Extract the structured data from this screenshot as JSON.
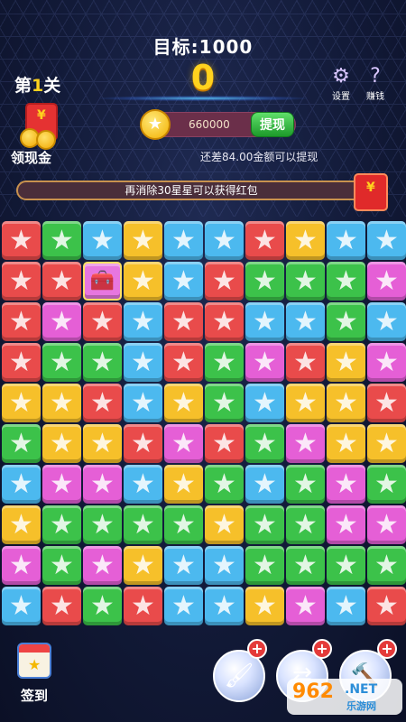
{
  "header": {
    "target_label": "目标:1000",
    "score": "0",
    "level_prefix": "第",
    "level_num": "1",
    "level_suffix": "关"
  },
  "top_icons": {
    "settings": {
      "icon": "gear-icon",
      "label": "设置"
    },
    "earn": {
      "icon": "question-icon",
      "label": "赚钱"
    }
  },
  "reward": {
    "claim_label": "领现金",
    "balance": "660000",
    "withdraw_label": "提现",
    "diff_text": "还差84.00金额可以提现"
  },
  "progress": {
    "text": "再消除30星星可以获得红包",
    "fraction": 0.0
  },
  "colors": {
    "red": "#e94b4b",
    "green": "#3cc24a",
    "blue": "#4cb9ef",
    "yellow": "#f6c02a",
    "pink": "#e55fd6"
  },
  "board": [
    [
      "red",
      "green",
      "blue",
      "yellow",
      "blue",
      "blue",
      "red",
      "yellow",
      "blue",
      "blue"
    ],
    [
      "red",
      "red",
      "chest",
      "yellow",
      "blue",
      "red",
      "green",
      "green",
      "green",
      "pink"
    ],
    [
      "red",
      "pink",
      "red",
      "blue",
      "red",
      "red",
      "blue",
      "blue",
      "green",
      "blue"
    ],
    [
      "red",
      "green",
      "green",
      "blue",
      "red",
      "green",
      "pink",
      "red",
      "yellow",
      "pink"
    ],
    [
      "yellow",
      "yellow",
      "red",
      "blue",
      "yellow",
      "green",
      "blue",
      "yellow",
      "yellow",
      "red"
    ],
    [
      "green",
      "yellow",
      "yellow",
      "red",
      "pink",
      "red",
      "green",
      "pink",
      "yellow",
      "yellow"
    ],
    [
      "blue",
      "pink",
      "pink",
      "blue",
      "yellow",
      "green",
      "blue",
      "green",
      "pink",
      "green"
    ],
    [
      "yellow",
      "green",
      "green",
      "green",
      "green",
      "yellow",
      "green",
      "green",
      "pink",
      "pink"
    ],
    [
      "pink",
      "green",
      "pink",
      "yellow",
      "blue",
      "blue",
      "green",
      "green",
      "green",
      "green"
    ],
    [
      "blue",
      "red",
      "green",
      "red",
      "blue",
      "blue",
      "yellow",
      "pink",
      "blue",
      "red"
    ]
  ],
  "bottom": {
    "checkin_label": "签到",
    "tools": [
      "brush-icon",
      "swap-icon",
      "hammer-icon"
    ]
  },
  "watermark": {
    "number": "962",
    "net": ".NET",
    "site": "乐游网"
  }
}
